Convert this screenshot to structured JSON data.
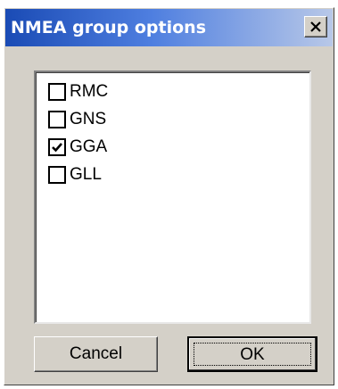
{
  "dialog": {
    "title": "NMEA group options",
    "colors": {
      "title_gradient_start": "#1a4bb5",
      "title_gradient_end": "#b8c8e8",
      "face": "#d4d0c8"
    },
    "close_icon": "close-icon"
  },
  "options": [
    {
      "label": "RMC",
      "checked": false
    },
    {
      "label": "GNS",
      "checked": false
    },
    {
      "label": "GGA",
      "checked": true
    },
    {
      "label": "GLL",
      "checked": false
    }
  ],
  "buttons": {
    "cancel_label": "Cancel",
    "ok_label": "OK"
  }
}
